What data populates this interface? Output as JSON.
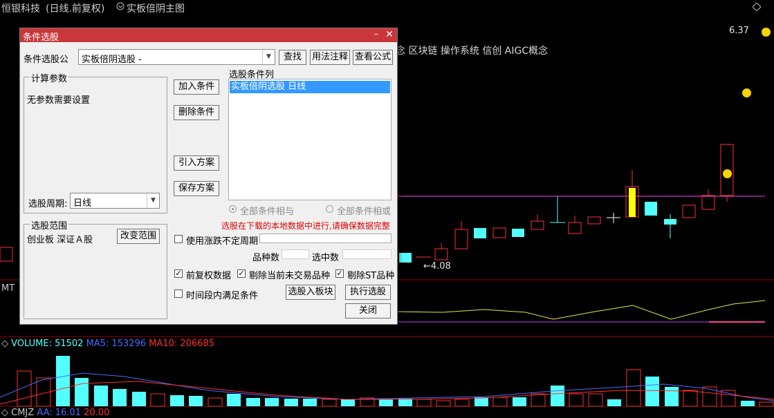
{
  "chart_title": {
    "stock": "恒银科技",
    "period": "(日线.前复权)",
    "indicator": "实板倍阴主图"
  },
  "price_marker_top": "6.37",
  "price_marker_low": "←4.08",
  "concepts_text": "念 区块链 操作系统 信创 AIGC概念",
  "mt_label": "MT",
  "volume_line": {
    "volume": "VOLUME: 51502",
    "ma5": "MA5: 153296",
    "ma10": "MA10: 206685"
  },
  "cmjz_line": {
    "name": "CMJZ",
    "aa": "AA: 16.01",
    "v2": "20.00"
  },
  "dialog": {
    "title": "条件选股",
    "min_icon": "minimize-icon",
    "close_icon": "close-icon",
    "formula_label": "条件选股公",
    "formula_value": "实板倍阴选股  -",
    "find_button": "查找",
    "usage_button": "用法注释",
    "view_formula_button": "查看公式",
    "params_group": "计算参数",
    "params_text": "无参数需要设置",
    "period_label": "选股周期:",
    "period_value": "日线",
    "add_condition": "加入条件",
    "delete_condition": "删除条件",
    "import_plan": "引入方案",
    "save_plan": "保存方案",
    "condition_list_label": "选股条件列",
    "condition_items": [
      "实板倍阴选股  日线"
    ],
    "radio_and": "全部条件相与",
    "radio_or": "全部条件相或",
    "warning": "选股在下载的本地数据中进行,请确保数据完整",
    "range_group": "选股范围",
    "range_value": "创业板 深证Ａ股",
    "change_range": "改变范围",
    "use_uncertain_period": "使用涨跌不定周期",
    "count_label": "品种数",
    "selected_label": "选中数",
    "forward_adjust": "前复权数据",
    "exclude_untraded": "剔除当前未交易品种",
    "exclude_st": "剔除ST品种",
    "time_period_satisfy": "时间段内满足条件",
    "add_to_block": "选股入板块",
    "execute": "执行选股",
    "close_button": "关闭"
  },
  "colors": {
    "dialog_title_bg": "#c9373a",
    "up_candle": "#ff3030",
    "down_candle": "#54ffff",
    "magenta_line": "#ff40ff",
    "warning_text": "#e00000",
    "selection": "#3399ff"
  }
}
